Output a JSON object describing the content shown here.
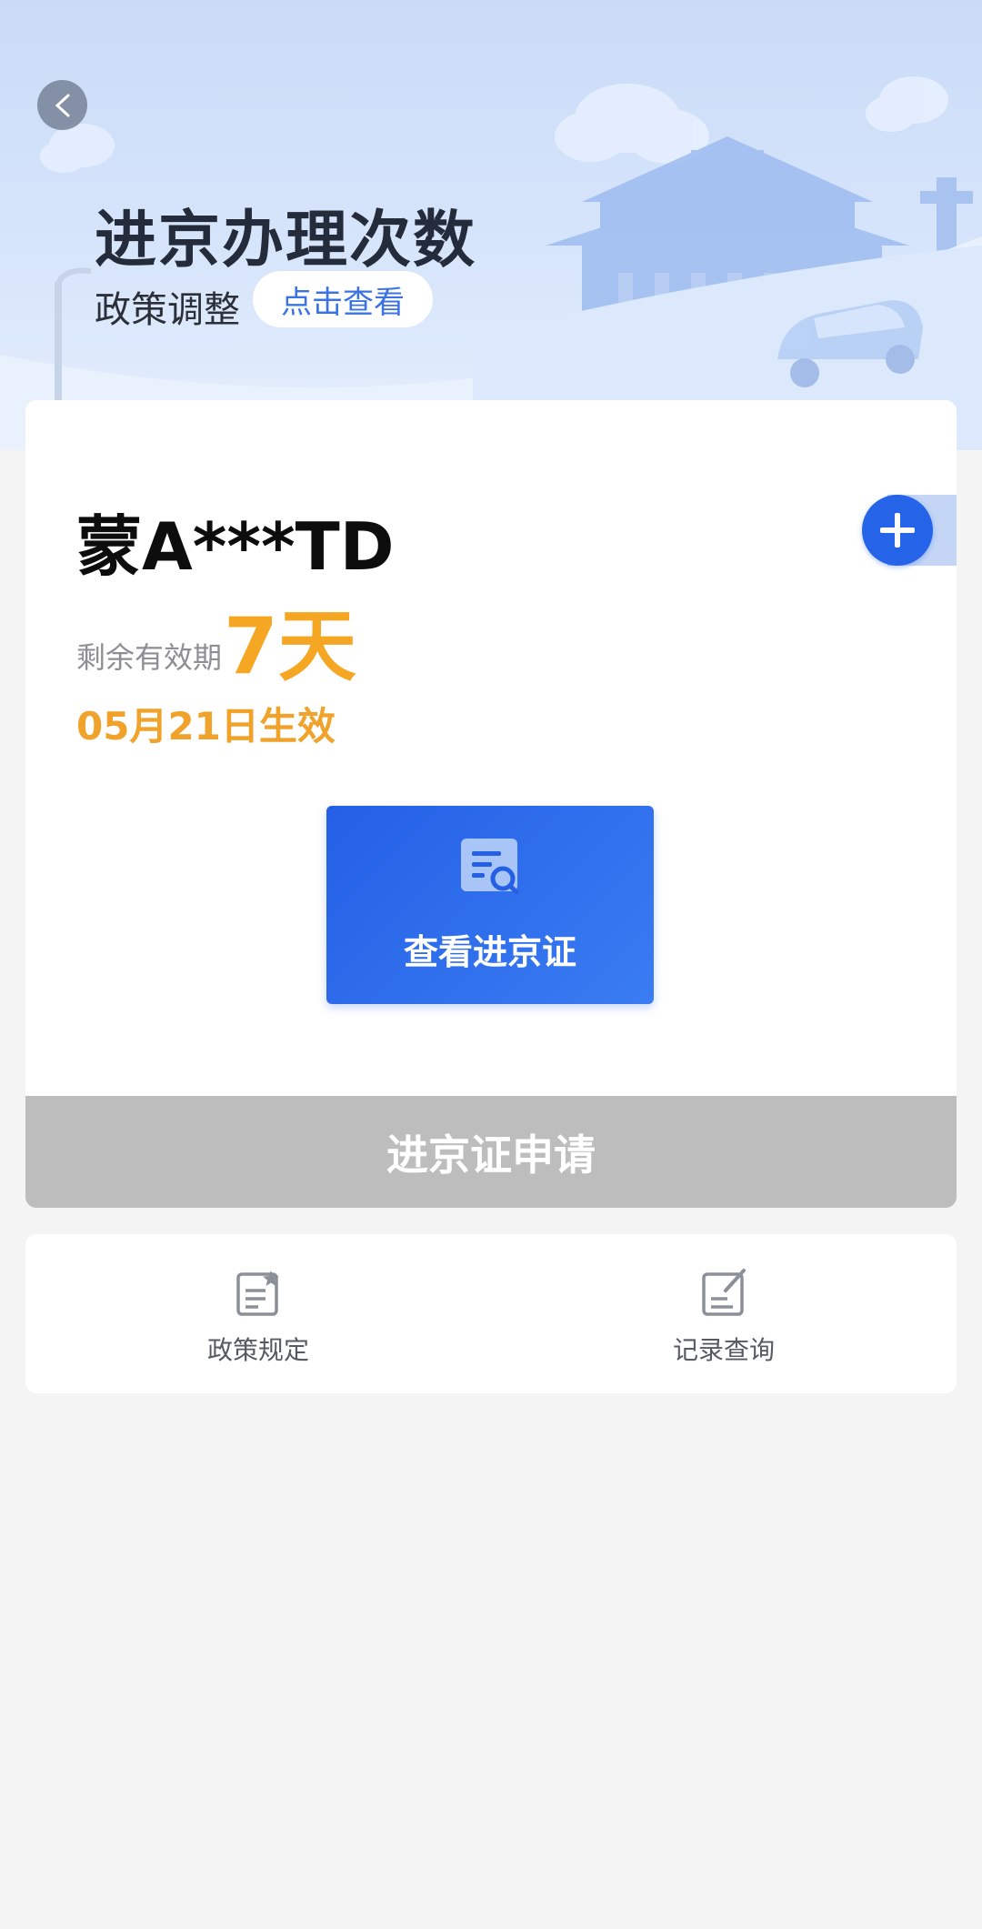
{
  "banner": {
    "title": "进京办理次数",
    "subtitle": "政策调整",
    "link_label": "点击查看"
  },
  "vehicle": {
    "plate": "蒙A***TD",
    "remaining_label": "剩余有效期",
    "remaining_value": "7天",
    "effective_text": "05月21日生效"
  },
  "actions": {
    "view_permit_label": "查看进京证",
    "apply_label": "进京证申请"
  },
  "menu": {
    "items": [
      {
        "label": "政策规定",
        "icon": "policy-document-icon"
      },
      {
        "label": "记录查询",
        "icon": "record-edit-icon"
      }
    ]
  },
  "colors": {
    "primary": "#2563e8",
    "accent_orange": "#f5a623",
    "disabled_gray": "#bdbdbd"
  }
}
